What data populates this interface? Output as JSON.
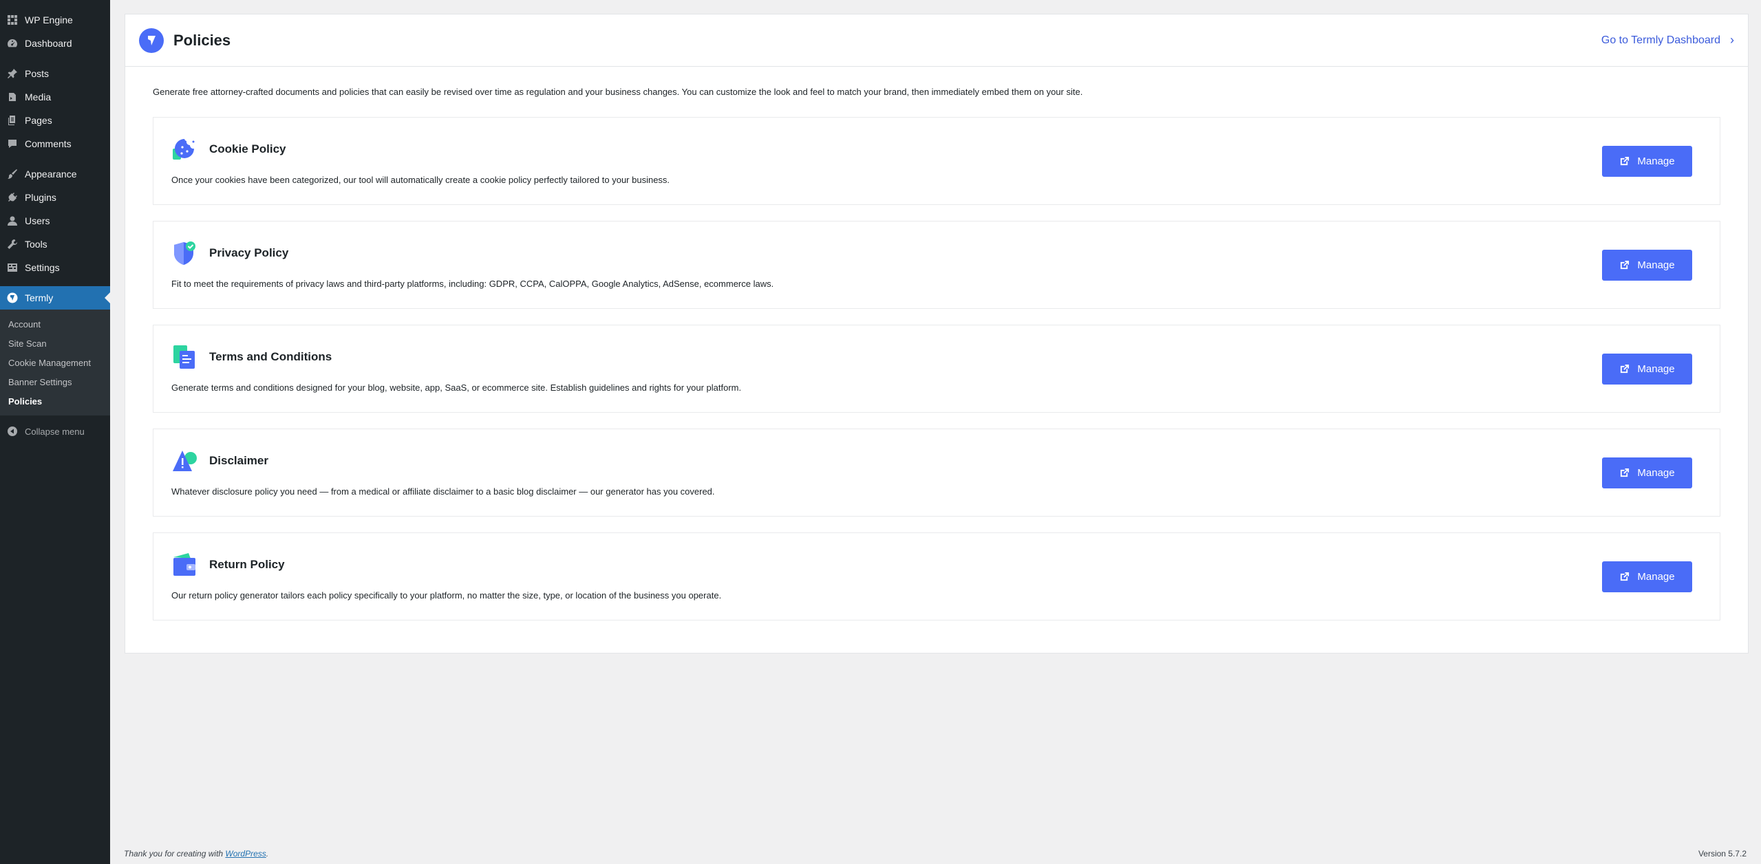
{
  "sidebar": {
    "items": [
      {
        "label": "WP Engine",
        "icon": "wpengine-icon"
      },
      {
        "label": "Dashboard",
        "icon": "dashboard-icon"
      },
      {
        "label": "Posts",
        "icon": "pin-icon"
      },
      {
        "label": "Media",
        "icon": "media-icon"
      },
      {
        "label": "Pages",
        "icon": "pages-icon"
      },
      {
        "label": "Comments",
        "icon": "comment-icon"
      },
      {
        "label": "Appearance",
        "icon": "brush-icon"
      },
      {
        "label": "Plugins",
        "icon": "plug-icon"
      },
      {
        "label": "Users",
        "icon": "user-icon"
      },
      {
        "label": "Tools",
        "icon": "wrench-icon"
      },
      {
        "label": "Settings",
        "icon": "settings-icon"
      },
      {
        "label": "Termly",
        "icon": "termly-icon"
      }
    ],
    "submenu": [
      "Account",
      "Site Scan",
      "Cookie Management",
      "Banner Settings",
      "Policies"
    ],
    "collapse_label": "Collapse menu"
  },
  "header": {
    "title": "Policies",
    "dashboard_link": "Go to Termly Dashboard"
  },
  "intro": "Generate free attorney-crafted documents and policies that can easily be revised over time as regulation and your business changes. You can customize the look and feel to match your brand, then immediately embed them on your site.",
  "policies": [
    {
      "title": "Cookie Policy",
      "description": "Once your cookies have been categorized, our tool will automatically create a cookie policy perfectly tailored to your business.",
      "button": "Manage"
    },
    {
      "title": "Privacy Policy",
      "description": "Fit to meet the requirements of privacy laws and third-party platforms, including: GDPR, CCPA, CalOPPA, Google Analytics, AdSense, ecommerce laws.",
      "button": "Manage"
    },
    {
      "title": "Terms and Conditions",
      "description": "Generate terms and conditions designed for your blog, website, app, SaaS, or ecommerce site. Establish guidelines and rights for your platform.",
      "button": "Manage"
    },
    {
      "title": "Disclaimer",
      "description": "Whatever disclosure policy you need — from a medical or affiliate disclaimer to a basic blog disclaimer — our generator has you covered.",
      "button": "Manage"
    },
    {
      "title": "Return Policy",
      "description": "Our return policy generator tailors each policy specifically to your platform, no matter the size, type, or location of the business you operate.",
      "button": "Manage"
    }
  ],
  "footer": {
    "thanks_prefix": "Thank you for creating with ",
    "wordpress_link": "WordPress",
    "thanks_suffix": ".",
    "version": "Version 5.7.2"
  },
  "colors": {
    "accent": "#4a6cf7",
    "wp_blue": "#2271b1",
    "sidebar_bg": "#1d2327",
    "green": "#2dd4a0"
  }
}
